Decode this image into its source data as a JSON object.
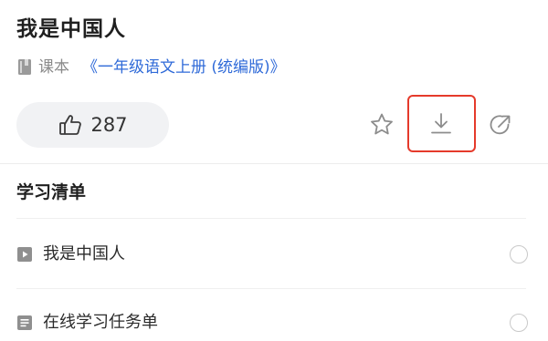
{
  "lesson": {
    "title": "我是中国人",
    "source_type": "课本",
    "source_book": "《一年级语文上册 (统编版)》"
  },
  "actions": {
    "like_count": "287",
    "icons": [
      "thumbs-up-icon",
      "star-icon",
      "download-icon",
      "share-icon"
    ],
    "highlight_color": "#e53a2b"
  },
  "study_list": {
    "title": "学习清单",
    "items": [
      {
        "label": "我是中国人",
        "icon": "video-icon"
      },
      {
        "label": "在线学习任务单",
        "icon": "document-icon"
      }
    ]
  },
  "colors": {
    "link": "#2f6ad8",
    "pill_bg": "#f1f2f4",
    "icon_gray": "#8c8c8c"
  }
}
